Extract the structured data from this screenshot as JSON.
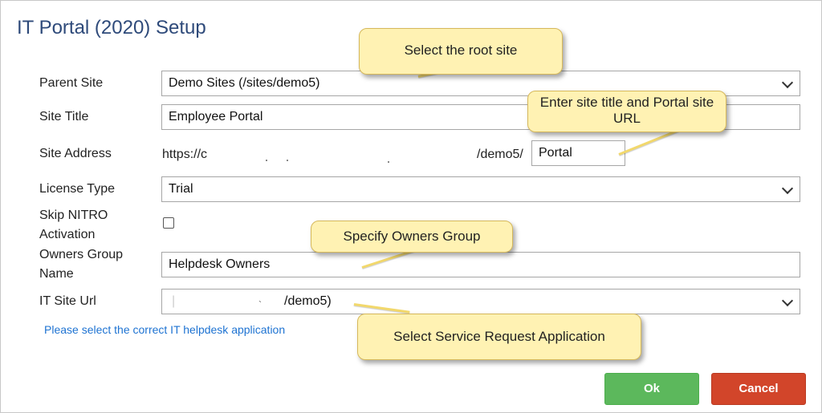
{
  "dialog": {
    "title": "IT Portal (2020) Setup"
  },
  "form": {
    "parent_site": {
      "label": "Parent Site",
      "value": "Demo Sites (/sites/demo5)"
    },
    "site_title": {
      "label": "Site Title",
      "value": "Employee Portal"
    },
    "site_address": {
      "label": "Site Address",
      "prefix": "https://c",
      "suffix": "/demo5/",
      "value": "Portal"
    },
    "license_type": {
      "label": "License Type",
      "value": "Trial"
    },
    "skip_nitro": {
      "label_line1": "Skip NITRO",
      "label_line2": "Activation",
      "checked": false
    },
    "owners_group": {
      "label_line1": "Owners Group",
      "label_line2": "Name",
      "value": "Helpdesk Owners"
    },
    "it_site_url": {
      "label": "IT Site Url",
      "value": "/demo5)"
    }
  },
  "helper_link": "Please select the correct IT helpdesk application",
  "buttons": {
    "ok": "Ok",
    "cancel": "Cancel"
  },
  "callouts": {
    "root_site": "Select the root site",
    "site_title": "Enter site title and Portal site URL",
    "owners_group": "Specify Owners Group",
    "service_request": "Select Service Request Application"
  },
  "colors": {
    "title": "#2e4a7a",
    "link": "#1e73d2",
    "ok_button": "#5cb85c",
    "cancel_button": "#d2452a",
    "callout_fill": "#fff2b3"
  }
}
